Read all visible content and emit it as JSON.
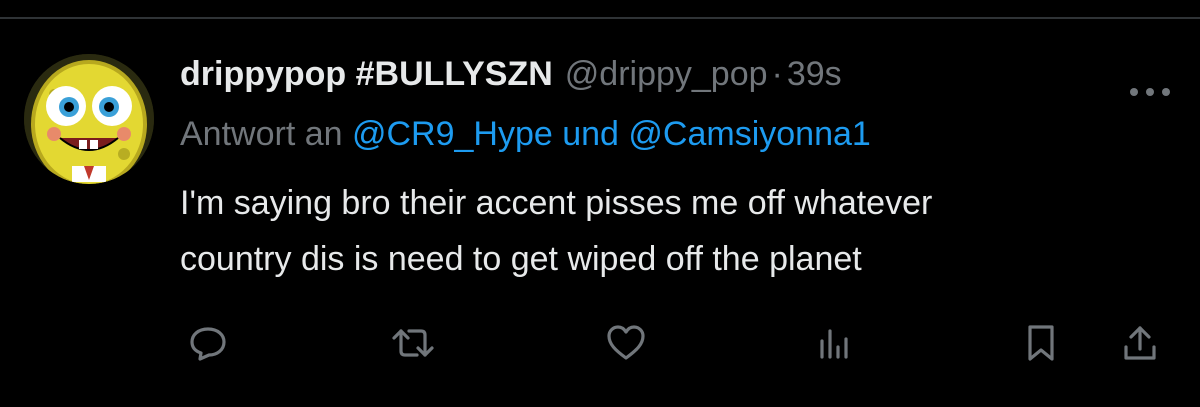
{
  "tweet": {
    "display_name": "drippypop #BULLYSZN",
    "handle": "@drippy_pop",
    "separator": "·",
    "time": "39s",
    "reply_prefix": "Antwort an",
    "reply_mentions": "@CR9_Hype und @Camsiyonna1",
    "text": "I'm saying bro their accent pisses me off whatever\ncountry dis is need to get wiped off the planet"
  },
  "icons": {
    "more": "more-horizontal-icon",
    "reply": "reply-bubble-icon",
    "retweet": "retweet-icon",
    "like": "heart-icon",
    "views": "analytics-icon",
    "bookmark": "bookmark-icon",
    "share": "share-upload-icon"
  },
  "colors": {
    "background": "#000000",
    "text": "#e7e9ea",
    "secondary": "#71767b",
    "link": "#1d9bf0",
    "divider": "#2f3336"
  }
}
